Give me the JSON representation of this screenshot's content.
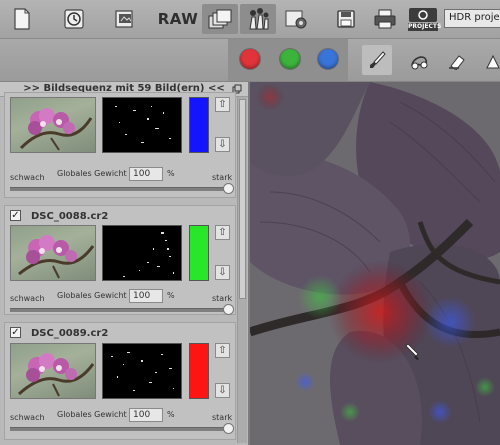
{
  "toolbar": {
    "raw_label": "RAW",
    "projects_label": "PROJECTS",
    "hdr_select_value": "HDR project",
    "buttons": [
      "new-document-icon",
      "history-icon",
      "open-folder-icon",
      "raw-button",
      "brackets-icon",
      "brushes-icon",
      "settings-icon",
      "save-icon",
      "print-icon",
      "projects-icon"
    ]
  },
  "subbar": {
    "colors": [
      "#e0343a",
      "#3cb43c",
      "#3a74d8"
    ],
    "tools": [
      "brush-icon",
      "lasso-icon",
      "eraser-icon",
      "stamp-icon"
    ]
  },
  "panel": {
    "title": ">> Bildsequenz mit 59 Bild(ern) <<",
    "frames": [
      {
        "name": "",
        "checked": false,
        "color": "#1414ff",
        "weight": "100",
        "weak_label": "schwach",
        "weight_label": "Globales Gewicht",
        "percent": "%",
        "strong_label": "stark",
        "slider_level": 1.0
      },
      {
        "name": "DSC_0088.cr2",
        "checked": true,
        "color": "#28e628",
        "weight": "100",
        "weak_label": "schwach",
        "weight_label": "Globales Gewicht",
        "percent": "%",
        "strong_label": "stark",
        "slider_level": 1.0
      },
      {
        "name": "DSC_0089.cr2",
        "checked": true,
        "color": "#ff1414",
        "weight": "100",
        "weak_label": "schwach",
        "weight_label": "Globales Gewicht",
        "percent": "%",
        "strong_label": "stark",
        "slider_level": 1.0
      }
    ],
    "check_mark": "✓",
    "up_arrow": "⇧",
    "down_arrow": "⇩"
  }
}
